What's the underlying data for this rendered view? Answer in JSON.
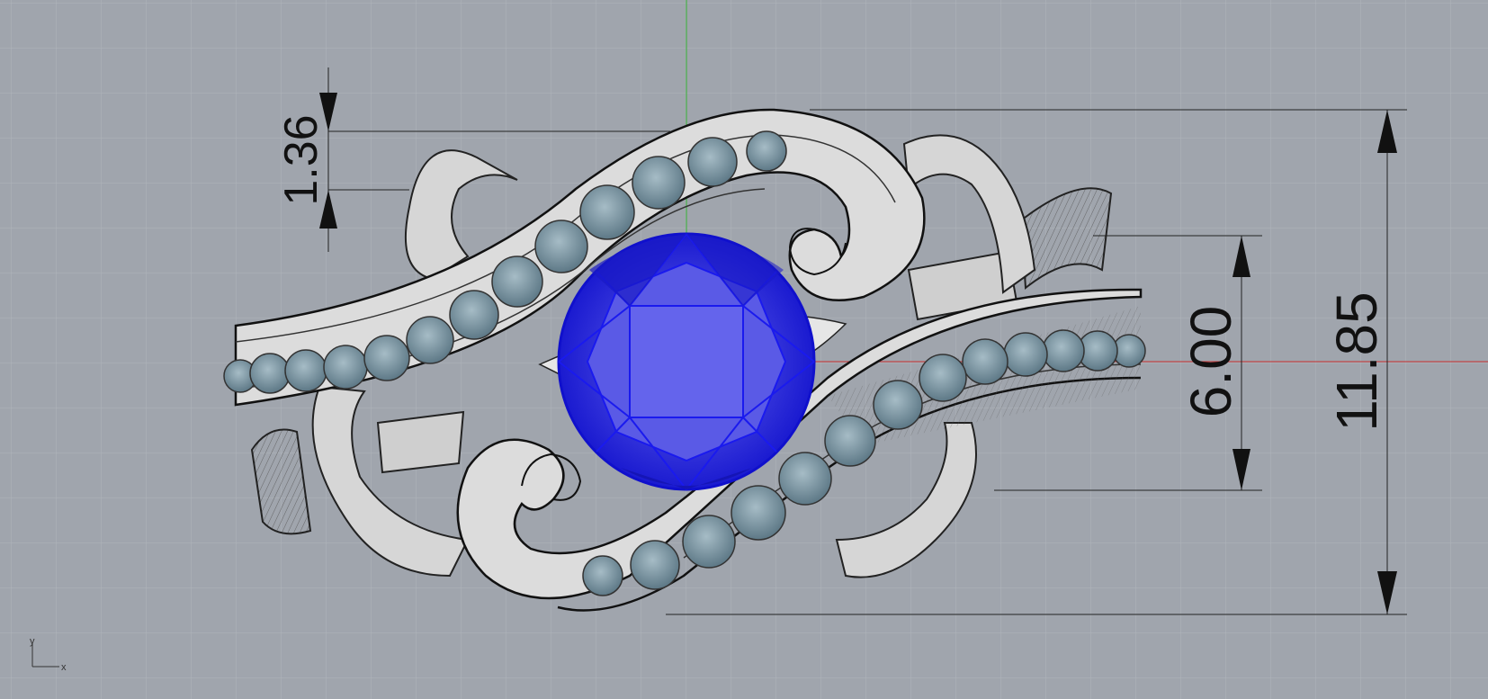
{
  "viewport": {
    "background": "#a0a5ad",
    "grid_color": "#b0b5bc",
    "x_axis_color": "#cc3333",
    "y_axis_color": "#33aa33"
  },
  "dimensions": {
    "top_setting": "1.36",
    "stone_height": "6.00",
    "overall_height": "11.85"
  },
  "axis_indicator": {
    "x_label": "x",
    "y_label": "y"
  },
  "model": {
    "center_stone_color": "#2424e6",
    "accent_stone_color": "#7a96a4",
    "metal_color": "#d8d8d8"
  }
}
